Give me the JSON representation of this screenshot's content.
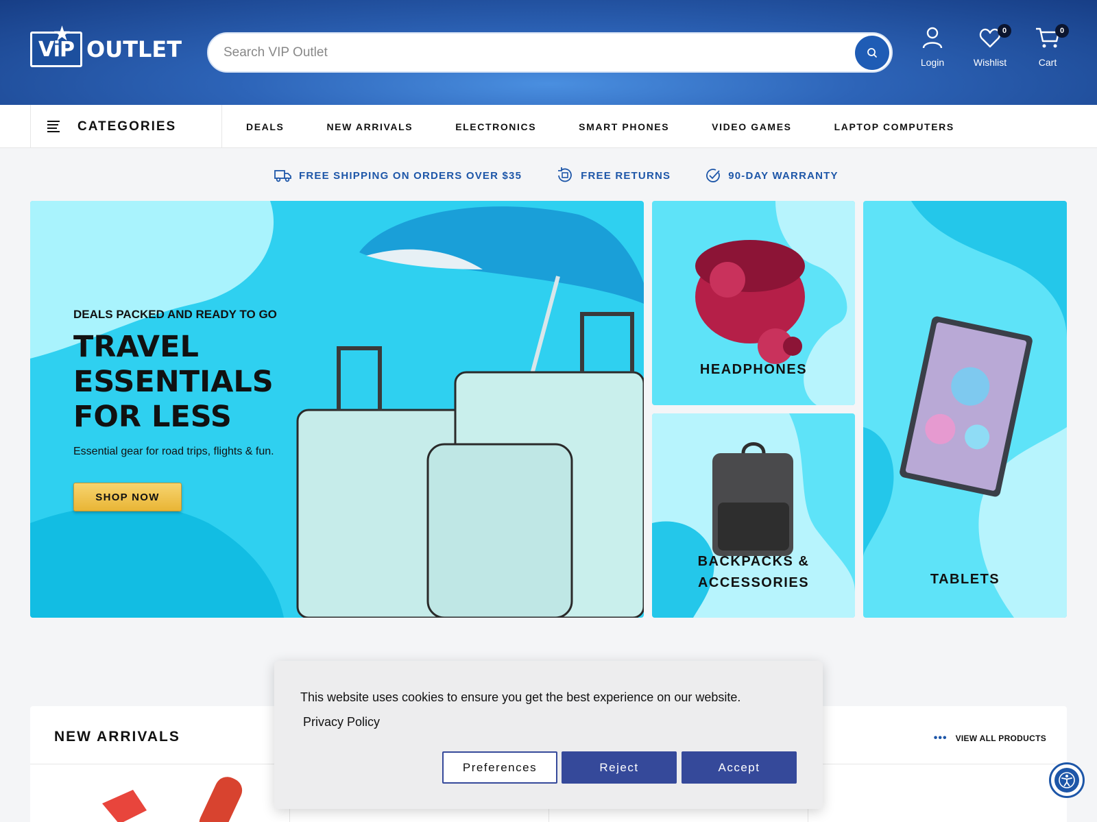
{
  "logo": {
    "badge": "ViP",
    "text": "OUTLET"
  },
  "search": {
    "placeholder": "Search VIP Outlet"
  },
  "header_icons": {
    "login": {
      "label": "Login"
    },
    "wishlist": {
      "label": "Wishlist",
      "count": "0"
    },
    "cart": {
      "label": "Cart",
      "count": "0"
    }
  },
  "nav": {
    "categories_label": "CATEGORIES",
    "links": [
      "DEALS",
      "NEW ARRIVALS",
      "ELECTRONICS",
      "SMART PHONES",
      "VIDEO GAMES",
      "LAPTOP COMPUTERS"
    ]
  },
  "perks": [
    {
      "icon": "truck-icon",
      "label": "FREE SHIPPING ON ORDERS OVER $35"
    },
    {
      "icon": "returns-icon",
      "label": "FREE RETURNS"
    },
    {
      "icon": "check-circle-icon",
      "label": "90-DAY WARRANTY"
    }
  ],
  "hero": {
    "kicker": "DEALS PACKED AND READY TO GO",
    "title": "TRAVEL ESSENTIALS FOR LESS",
    "subtitle": "Essential gear for road trips, flights & fun.",
    "cta": "SHOP NOW"
  },
  "tiles": {
    "headphones": "HEADPHONES",
    "backpacks": "BACKPACKS & ACCESSORIES",
    "tablets": "TABLETS"
  },
  "new_arrivals": {
    "title": "NEW ARRIVALS",
    "view_all": "VIEW ALL PRODUCTS"
  },
  "cookie": {
    "message": "This website uses cookies to ensure you get the best experience on our website.",
    "privacy_link": "Privacy Policy",
    "preferences": "Preferences",
    "reject": "Reject",
    "accept": "Accept"
  },
  "colors": {
    "brand_blue": "#1d56a8",
    "hero_cyan": "#2fd0f0",
    "cookie_button": "#35499a",
    "cta_yellow": "#f2c54e"
  }
}
